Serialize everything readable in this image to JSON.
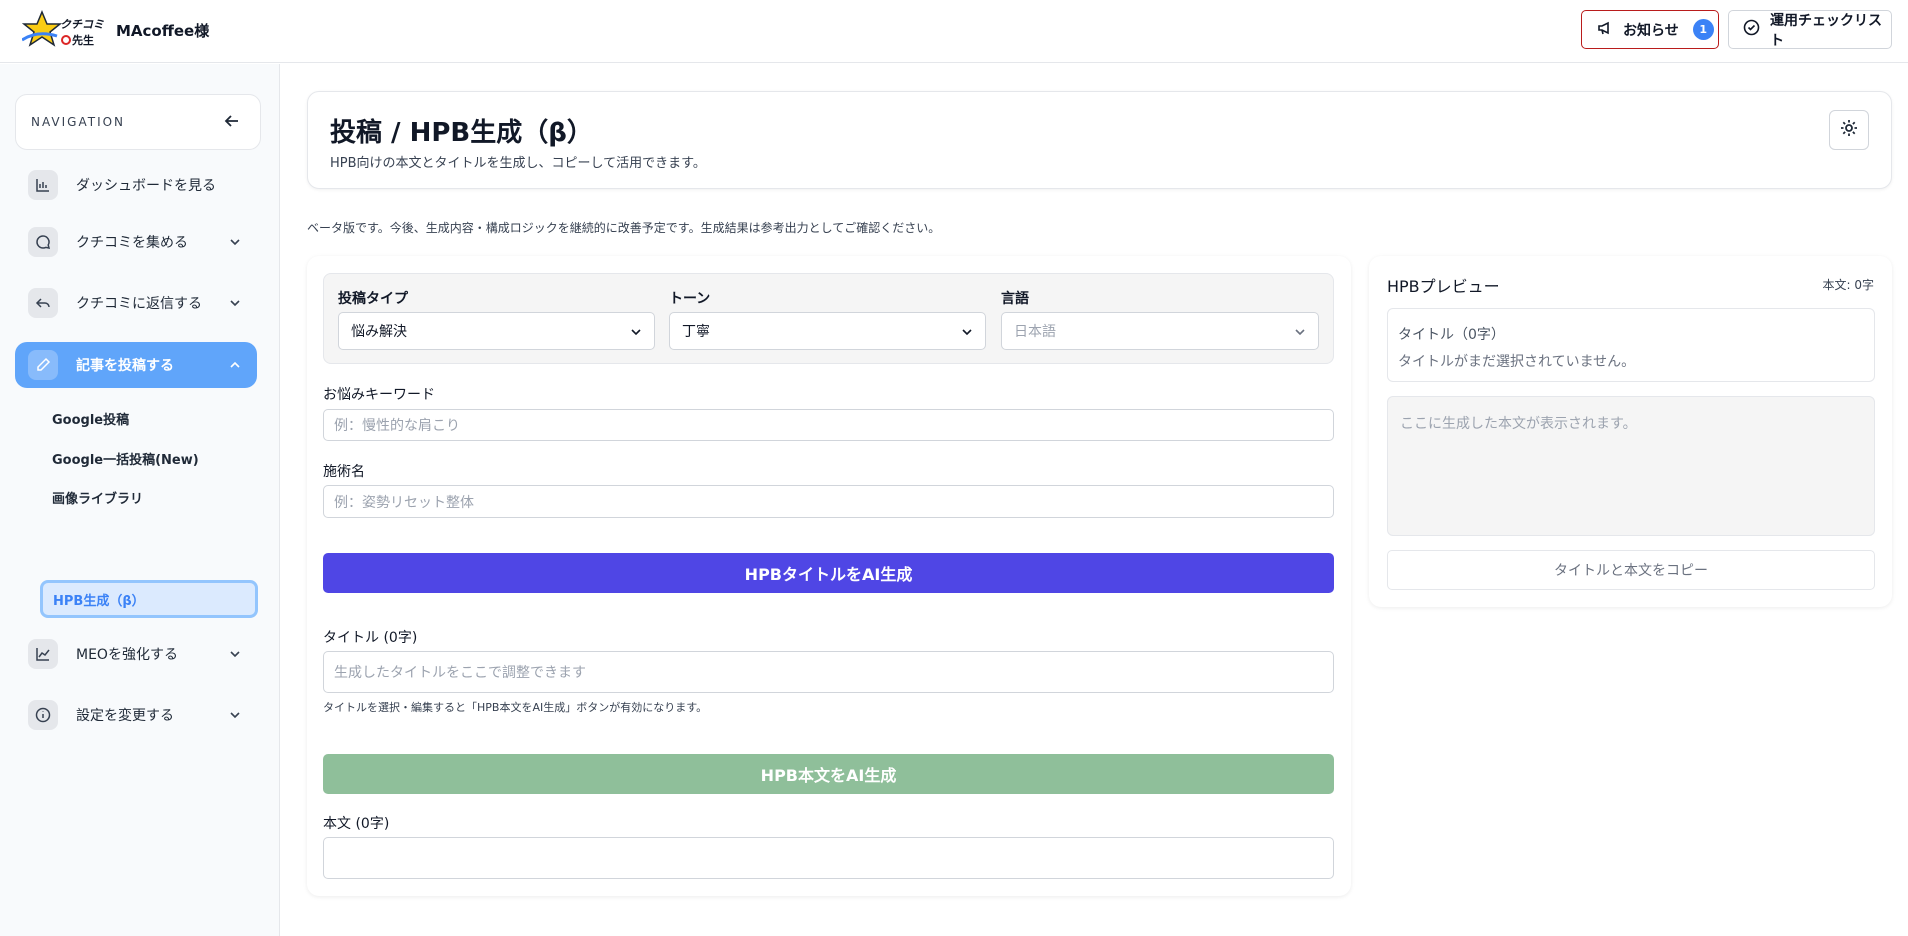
{
  "header": {
    "logo_text": "クチコミ先生",
    "store_name": "MAcoffee様",
    "notice_label": "お知らせ",
    "notice_count": "1",
    "checklist_label": "運用チェックリスト"
  },
  "sidebar": {
    "nav_heading": "NAVIGATION",
    "items": [
      {
        "label": "ダッシュボードを見る",
        "icon": "bar-chart-icon"
      },
      {
        "label": "クチコミを集める",
        "icon": "chat-bubble-icon"
      },
      {
        "label": "クチコミに返信する",
        "icon": "reply-arrow-icon"
      },
      {
        "label": "記事を投稿する",
        "icon": "pencil-icon",
        "active": true
      },
      {
        "label": "MEOを強化する",
        "icon": "trend-line-icon"
      },
      {
        "label": "設定を変更する",
        "icon": "info-circle-icon"
      }
    ],
    "subitems": [
      "Google投稿",
      "Google一括投稿(New)",
      "画像ライブラリ",
      "HPB生成（β）"
    ]
  },
  "page": {
    "title": "投稿 / HPB生成（β）",
    "subtitle": "HPB向けの本文とタイトルを生成し、コピーして活用できます。",
    "beta_note": "ベータ版です。今後、生成内容・構成ロジックを継続的に改善予定です。生成結果は参考出力としてご確認ください。"
  },
  "form": {
    "post_type_label": "投稿タイプ",
    "post_type_value": "悩み解決",
    "tone_label": "トーン",
    "tone_value": "丁寧",
    "language_label": "言語",
    "language_value": "日本語",
    "keyword_label": "お悩みキーワード",
    "keyword_placeholder": "例：慢性的な肩こり",
    "treatment_label": "施術名",
    "treatment_placeholder": "例：姿勢リセット整体",
    "generate_title_button": "HPBタイトルをAI生成",
    "title_label": "タイトル (0字)",
    "title_placeholder": "生成したタイトルをここで調整できます",
    "title_help": "タイトルを選択・編集すると「HPB本文をAI生成」ボタンが有効になります。",
    "generate_body_button": "HPB本文をAI生成",
    "body_label": "本文 (0字)"
  },
  "preview": {
    "heading": "HPBプレビュー",
    "body_count": "本文: 0字",
    "title_label": "タイトル（0字）",
    "title_empty": "タイトルがまだ選択されていません。",
    "body_placeholder": "ここに生成した本文が表示されます。",
    "copy_button": "タイトルと本文をコピー"
  },
  "colors": {
    "accent": "#60a5fa",
    "primary_button": "#4f46e5",
    "disabled_button": "#8fbf9a",
    "notice_border": "#b91c1c"
  }
}
